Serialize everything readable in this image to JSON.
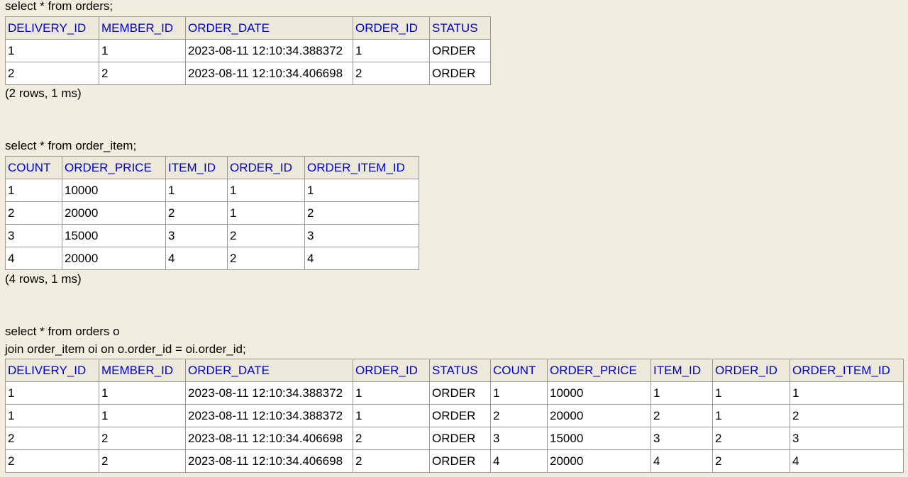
{
  "query1": {
    "sql": "select * from orders;",
    "columns": [
      "DELIVERY_ID",
      "MEMBER_ID",
      "ORDER_DATE",
      "ORDER_ID",
      "STATUS"
    ],
    "rows": [
      [
        "1",
        "1",
        "2023-08-11 12:10:34.388372",
        "1",
        "ORDER"
      ],
      [
        "2",
        "2",
        "2023-08-11 12:10:34.406698",
        "2",
        "ORDER"
      ]
    ],
    "summary": "(2 rows, 1 ms)"
  },
  "query2": {
    "sql": "select * from order_item;",
    "columns": [
      "COUNT",
      "ORDER_PRICE",
      "ITEM_ID",
      "ORDER_ID",
      "ORDER_ITEM_ID"
    ],
    "rows": [
      [
        "1",
        "10000",
        "1",
        "1",
        "1"
      ],
      [
        "2",
        "20000",
        "2",
        "1",
        "2"
      ],
      [
        "3",
        "15000",
        "3",
        "2",
        "3"
      ],
      [
        "4",
        "20000",
        "4",
        "2",
        "4"
      ]
    ],
    "summary": "(4 rows, 1 ms)"
  },
  "query3": {
    "sql_line1": "select * from orders o",
    "sql_line2": "join order_item oi on o.order_id = oi.order_id;",
    "columns": [
      "DELIVERY_ID",
      "MEMBER_ID",
      "ORDER_DATE",
      "ORDER_ID",
      "STATUS",
      "COUNT",
      "ORDER_PRICE",
      "ITEM_ID",
      "ORDER_ID",
      "ORDER_ITEM_ID"
    ],
    "rows": [
      [
        "1",
        "1",
        "2023-08-11 12:10:34.388372",
        "1",
        "ORDER",
        "1",
        "10000",
        "1",
        "1",
        "1"
      ],
      [
        "1",
        "1",
        "2023-08-11 12:10:34.388372",
        "1",
        "ORDER",
        "2",
        "20000",
        "2",
        "1",
        "2"
      ],
      [
        "2",
        "2",
        "2023-08-11 12:10:34.406698",
        "2",
        "ORDER",
        "3",
        "15000",
        "3",
        "2",
        "3"
      ],
      [
        "2",
        "2",
        "2023-08-11 12:10:34.406698",
        "2",
        "ORDER",
        "4",
        "20000",
        "4",
        "2",
        "4"
      ]
    ]
  },
  "colors": {
    "background": "#f2eedf",
    "header_link": "#0000cc",
    "header_bg": "#ece8da",
    "cell_bg": "#ffffff",
    "border": "#999999"
  }
}
